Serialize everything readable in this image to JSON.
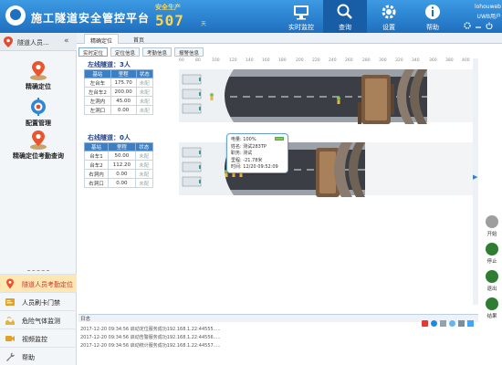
{
  "header": {
    "title": "施工隧道安全管控平台",
    "safety_label": "安全生产",
    "safety_days": "507",
    "safety_unit": "天",
    "nav": [
      {
        "label": "实时监控",
        "icon": "monitor-icon",
        "active": false
      },
      {
        "label": "查询",
        "icon": "search-icon",
        "active": true
      },
      {
        "label": "设置",
        "icon": "gear-icon",
        "active": false
      },
      {
        "label": "帮助",
        "icon": "info-icon",
        "active": false
      }
    ],
    "user": {
      "name": "lohouweb",
      "role": "UWB用户"
    }
  },
  "sidebar": {
    "header_label": "隧道人员...",
    "features": [
      {
        "label": "精确定位",
        "icon": "location-pin-icon"
      },
      {
        "label": "配置管理",
        "icon": "config-icon"
      },
      {
        "label": "精确定位考勤查询",
        "icon": "attendance-query-icon"
      }
    ],
    "items": [
      {
        "label": "隧道人员考勤定位",
        "icon": "location-pin-icon",
        "active": true
      },
      {
        "label": "人员刷卡门禁",
        "icon": "card-gate-icon",
        "active": false
      },
      {
        "label": "危险气体监测",
        "icon": "gas-icon",
        "active": false
      },
      {
        "label": "视频监控",
        "icon": "camera-icon",
        "active": false
      },
      {
        "label": "帮助",
        "icon": "wrench-icon",
        "active": false
      }
    ]
  },
  "tabs": [
    {
      "label": "精确定位",
      "active": true
    },
    {
      "label": "首页",
      "active": false
    }
  ],
  "subtabs": [
    {
      "label": "实时定位",
      "active": true
    },
    {
      "label": "定位信息",
      "active": false
    },
    {
      "label": "考勤信息",
      "active": false
    },
    {
      "label": "报警信息",
      "active": false
    }
  ],
  "ruler_ticks": [
    "60",
    "80",
    "100",
    "120",
    "140",
    "160",
    "180",
    "200",
    "220",
    "240",
    "260",
    "280",
    "300",
    "320",
    "340",
    "360",
    "380",
    "400"
  ],
  "left_tunnel": {
    "title": "左线隧道：3人",
    "columns": [
      "基站",
      "里程",
      "状态"
    ],
    "rows": [
      [
        "左台车",
        "175.70",
        "未配"
      ],
      [
        "左台车2",
        "200.00",
        "未配"
      ],
      [
        "左洞内",
        "45.00",
        "未配"
      ],
      [
        "左洞口",
        "0.00",
        "未配"
      ]
    ]
  },
  "right_tunnel": {
    "title": "右线隧道：0人",
    "columns": [
      "基站",
      "里程",
      "状态"
    ],
    "rows": [
      [
        "台车1",
        "50.00",
        "未配"
      ],
      [
        "台车2",
        "112.20",
        "未配"
      ],
      [
        "右洞内",
        "0.00",
        "未配"
      ],
      [
        "右洞口",
        "0.00",
        "未配"
      ]
    ]
  },
  "tooltip": {
    "lines": [
      "电量: 100%",
      "姓名: 测试283TP",
      "职务: 测试",
      "里程: -21.78米",
      "时间: 12/20 09:52:09"
    ]
  },
  "controls": [
    {
      "label": "开始",
      "color": "#9e9e9e"
    },
    {
      "label": "停止",
      "color": "#2e7d32"
    },
    {
      "label": "退出",
      "color": "#2e7d32"
    },
    {
      "label": "结果",
      "color": "#2e7d32"
    }
  ],
  "log": {
    "header": "日志",
    "lines": [
      "2017-12-20 09:34:56   启动定位服务成功192.168.1.22:44555.....",
      "2017-12-20 09:34:56   启动告警服务成功192.168.1.22:44556.....",
      "2017-12-20 09:34:56   启动统计服务成功192.168.1.22:44557....."
    ]
  }
}
